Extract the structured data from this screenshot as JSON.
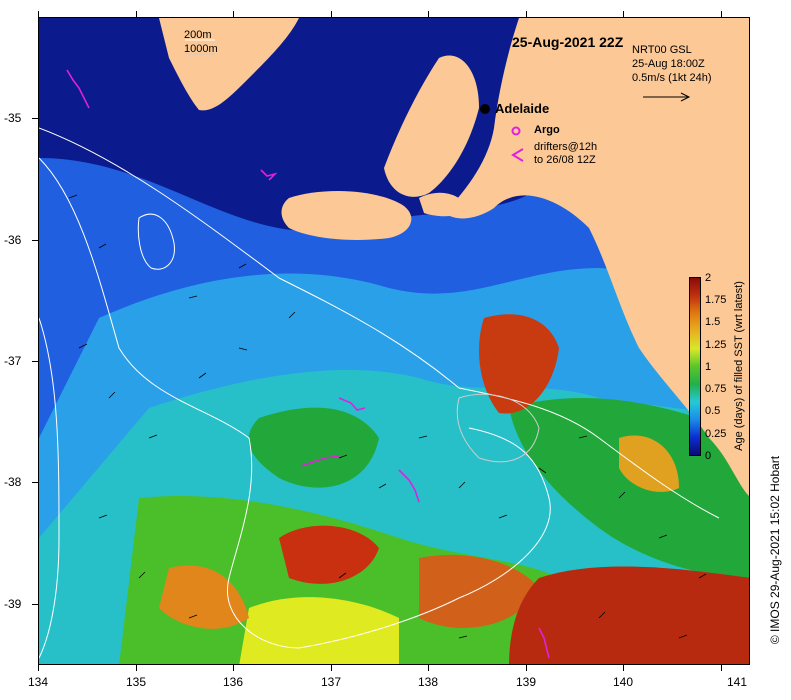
{
  "header": {
    "date_title": "25-Aug-2021 22Z",
    "product_line1": "NRT00 GSL",
    "product_line2": "25-Aug 18:00Z",
    "product_line3": "0.5m/s (1kt 24h)"
  },
  "legend": {
    "isobath_1": "200m",
    "isobath_2": "1000m",
    "city": "Adelaide",
    "argo": "Argo",
    "drifters_line1": "drifters@12h",
    "drifters_line2": "to 26/08 12Z"
  },
  "axes": {
    "x_ticks": [
      "134",
      "135",
      "136",
      "137",
      "138",
      "139",
      "140",
      "141"
    ],
    "y_ticks": [
      "-35",
      "-36",
      "-37",
      "-38",
      "-39"
    ]
  },
  "colorbar": {
    "title": "Age (days) of filled SST (wrt latest)",
    "labels": [
      "2",
      "1.75",
      "1.5",
      "1.25",
      "1",
      "0.75",
      "0.5",
      "0.25",
      "0"
    ],
    "colors": [
      "#0a0a78",
      "#0b2fd0",
      "#1a8ce8",
      "#27c8d8",
      "#22b04a",
      "#5ac62a",
      "#d8e82a",
      "#e8b020",
      "#e07a10",
      "#c03010",
      "#8a0a0a"
    ]
  },
  "footer": {
    "copyright": "© IMOS 29-Aug-2021 15:02 Hobart"
  },
  "colors": {
    "land": "#fbc896",
    "deep_ocean": "#0b1a8c",
    "isobath": "#ffffff",
    "argo": "#e020e0"
  }
}
